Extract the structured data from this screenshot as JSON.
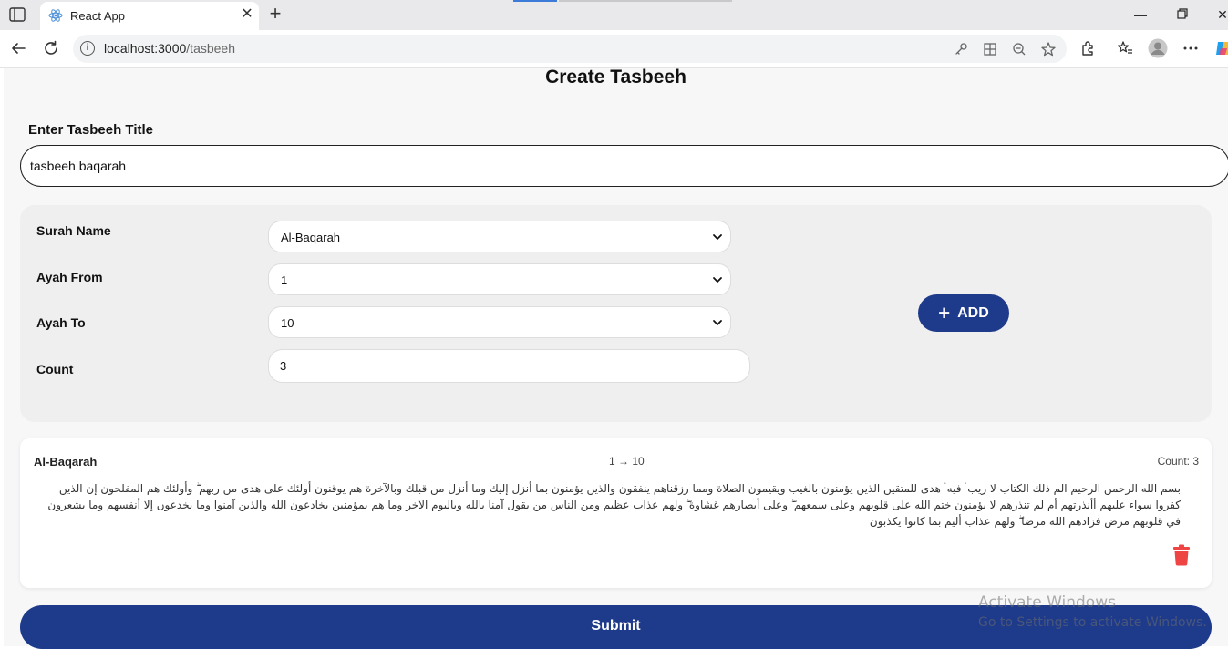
{
  "browser": {
    "tab_title": "React App",
    "url_host": "localhost:3000",
    "url_path": "/tasbeeh"
  },
  "page": {
    "title": "Create Tasbeeh",
    "title_label": "Enter Tasbeeh Title",
    "title_value": "tasbeeh baqarah"
  },
  "form": {
    "surah_label": "Surah Name",
    "surah_value": "Al-Baqarah",
    "ayah_from_label": "Ayah From",
    "ayah_from_value": "1",
    "ayah_to_label": "Ayah To",
    "ayah_to_value": "10",
    "count_label": "Count",
    "count_value": "3",
    "add_label": "ADD"
  },
  "entry": {
    "surah": "Al-Baqarah",
    "range": "1 → 10",
    "count": "Count: 3",
    "text": "بسم الله الرحمن الرحيم الم ذلك الكتاب لا ريب ۛ فيه ۛ هدى للمتقين الذين يؤمنون بالغيب ويقيمون الصلاة ومما رزقناهم ينفقون والذين يؤمنون بما أنزل إليك وما أنزل من قبلك وبالآخرة هم يوقنون أولئك على هدى من ربهم ۖ وأولئك هم المفلحون إن الذين كفروا سواء عليهم أأنذرتهم أم لم تنذرهم لا يؤمنون ختم الله على قلوبهم وعلى سمعهم ۖ وعلى أبصارهم غشاوة ۖ ولهم عذاب عظيم ومن الناس من يقول آمنا بالله وباليوم الآخر وما هم بمؤمنين يخادعون الله والذين آمنوا وما يخدعون إلا أنفسهم وما يشعرون في قلوبهم مرض فزادهم الله مرضا ۖ ولهم عذاب أليم بما كانوا يكذبون"
  },
  "submit_label": "Submit",
  "watermark": {
    "line1": "Activate Windows",
    "line2": "Go to Settings to activate Windows."
  },
  "colors": {
    "primary": "#1e3a8a",
    "danger": "#ef4444",
    "card_bg": "#efefef"
  },
  "icons": [
    "sidebar-icon",
    "react-logo-icon",
    "close-icon",
    "plus-icon",
    "back-icon",
    "reload-icon",
    "info-icon",
    "key-icon",
    "grid-icon",
    "zoom-out-icon",
    "star-icon",
    "extensions-icon",
    "favorites-icon",
    "avatar",
    "more-icon",
    "copilot-icon",
    "chevron-down-icon",
    "trash-icon"
  ]
}
